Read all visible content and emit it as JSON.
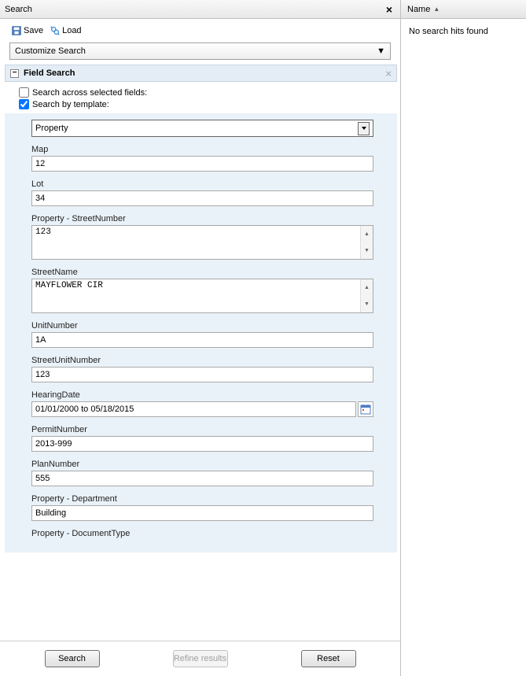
{
  "leftPanel": {
    "title": "Search",
    "toolbar": {
      "save": "Save",
      "load": "Load"
    },
    "customize": "Customize Search",
    "section": {
      "title": "Field Search",
      "searchAcross": "Search across selected fields:",
      "searchByTemplate": "Search by template:",
      "templateValue": "Property"
    },
    "fields": {
      "map": {
        "label": "Map",
        "value": "12"
      },
      "lot": {
        "label": "Lot",
        "value": "34"
      },
      "streetNumber": {
        "label": "Property - StreetNumber",
        "value": "123"
      },
      "streetName": {
        "label": "StreetName",
        "value": "MAYFLOWER CIR"
      },
      "unitNumber": {
        "label": "UnitNumber",
        "value": "1A"
      },
      "streetUnitNumber": {
        "label": "StreetUnitNumber",
        "value": "123"
      },
      "hearingDate": {
        "label": "HearingDate",
        "value": "01/01/2000 to 05/18/2015"
      },
      "permitNumber": {
        "label": "PermitNumber",
        "value": "2013-999"
      },
      "planNumber": {
        "label": "PlanNumber",
        "value": "555"
      },
      "department": {
        "label": "Property - Department",
        "value": "Building"
      },
      "documentType": {
        "label": "Property - DocumentType",
        "value": ""
      }
    },
    "buttons": {
      "search": "Search",
      "refine": "Refine results",
      "reset": "Reset"
    }
  },
  "rightPanel": {
    "column": "Name",
    "message": "No search hits found"
  }
}
